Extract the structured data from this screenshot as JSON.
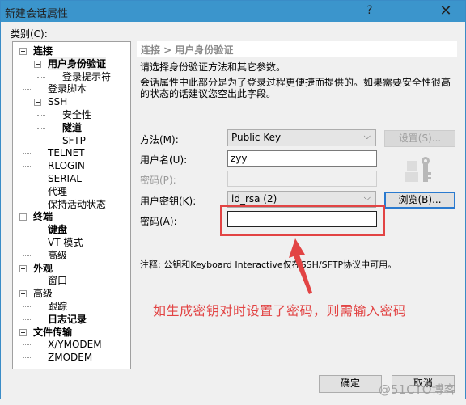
{
  "window": {
    "title": "新建会话属性",
    "help_label": "?",
    "close_label": "✕"
  },
  "category": {
    "label": "类别(C):",
    "tree": [
      {
        "label": "连接",
        "level": 0,
        "bold": true,
        "expander": true
      },
      {
        "label": "用户身份验证",
        "level": 1,
        "bold": true,
        "expander": true,
        "selected": true
      },
      {
        "label": "登录提示符",
        "level": 2,
        "bold": false
      },
      {
        "label": "登录脚本",
        "level": 1,
        "bold": false
      },
      {
        "label": "SSH",
        "level": 1,
        "bold": false,
        "expander": true
      },
      {
        "label": "安全性",
        "level": 2,
        "bold": false
      },
      {
        "label": "隧道",
        "level": 2,
        "bold": true
      },
      {
        "label": "SFTP",
        "level": 2,
        "bold": false
      },
      {
        "label": "TELNET",
        "level": 1,
        "bold": false
      },
      {
        "label": "RLOGIN",
        "level": 1,
        "bold": false
      },
      {
        "label": "SERIAL",
        "level": 1,
        "bold": false
      },
      {
        "label": "代理",
        "level": 1,
        "bold": false
      },
      {
        "label": "保持活动状态",
        "level": 1,
        "bold": false
      },
      {
        "label": "终端",
        "level": 0,
        "bold": true,
        "expander": true
      },
      {
        "label": "键盘",
        "level": 1,
        "bold": true
      },
      {
        "label": "VT 模式",
        "level": 1,
        "bold": false
      },
      {
        "label": "高级",
        "level": 1,
        "bold": false
      },
      {
        "label": "外观",
        "level": 0,
        "bold": true,
        "expander": true
      },
      {
        "label": "窗口",
        "level": 1,
        "bold": false
      },
      {
        "label": "高级",
        "level": 0,
        "bold": false,
        "expander": true
      },
      {
        "label": "跟踪",
        "level": 1,
        "bold": false
      },
      {
        "label": "日志记录",
        "level": 1,
        "bold": true
      },
      {
        "label": "文件传输",
        "level": 0,
        "bold": true,
        "expander": true
      },
      {
        "label": "X/YMODEM",
        "level": 1,
        "bold": false
      },
      {
        "label": "ZMODEM",
        "level": 1,
        "bold": false
      }
    ]
  },
  "panel": {
    "breadcrumb": "连接 > 用户身份验证",
    "desc1": "请选择身份验证方法和其它参数。",
    "desc2_line1": "会话属性中此部分是为了登录过程更便捷而提供的。如果需要安全性很高",
    "desc2_line2": "的状态的话建议您空出此字段。",
    "method_label": "方法(M):",
    "method_value": "Public Key",
    "settings_button": "设置(S)...",
    "username_label": "用户名(U):",
    "username_value": "zyy",
    "password_label": "密码(P):",
    "password_value": "",
    "userkey_label": "用户密钥(K):",
    "userkey_value": "id_rsa (2)",
    "browse_button": "浏览(B)...",
    "passphrase_label": "密码(A):",
    "passphrase_value": "",
    "note": "注释: 公钥和Keyboard Interactive仅在SSH/SFTP协议中可用。"
  },
  "annotation": {
    "text": "如生成密钥对时设置了密码，则需输入密码",
    "color": "#e24444"
  },
  "footer": {
    "ok_button": "确定",
    "cancel_button": "取消"
  },
  "watermark": "@51CTO博客"
}
